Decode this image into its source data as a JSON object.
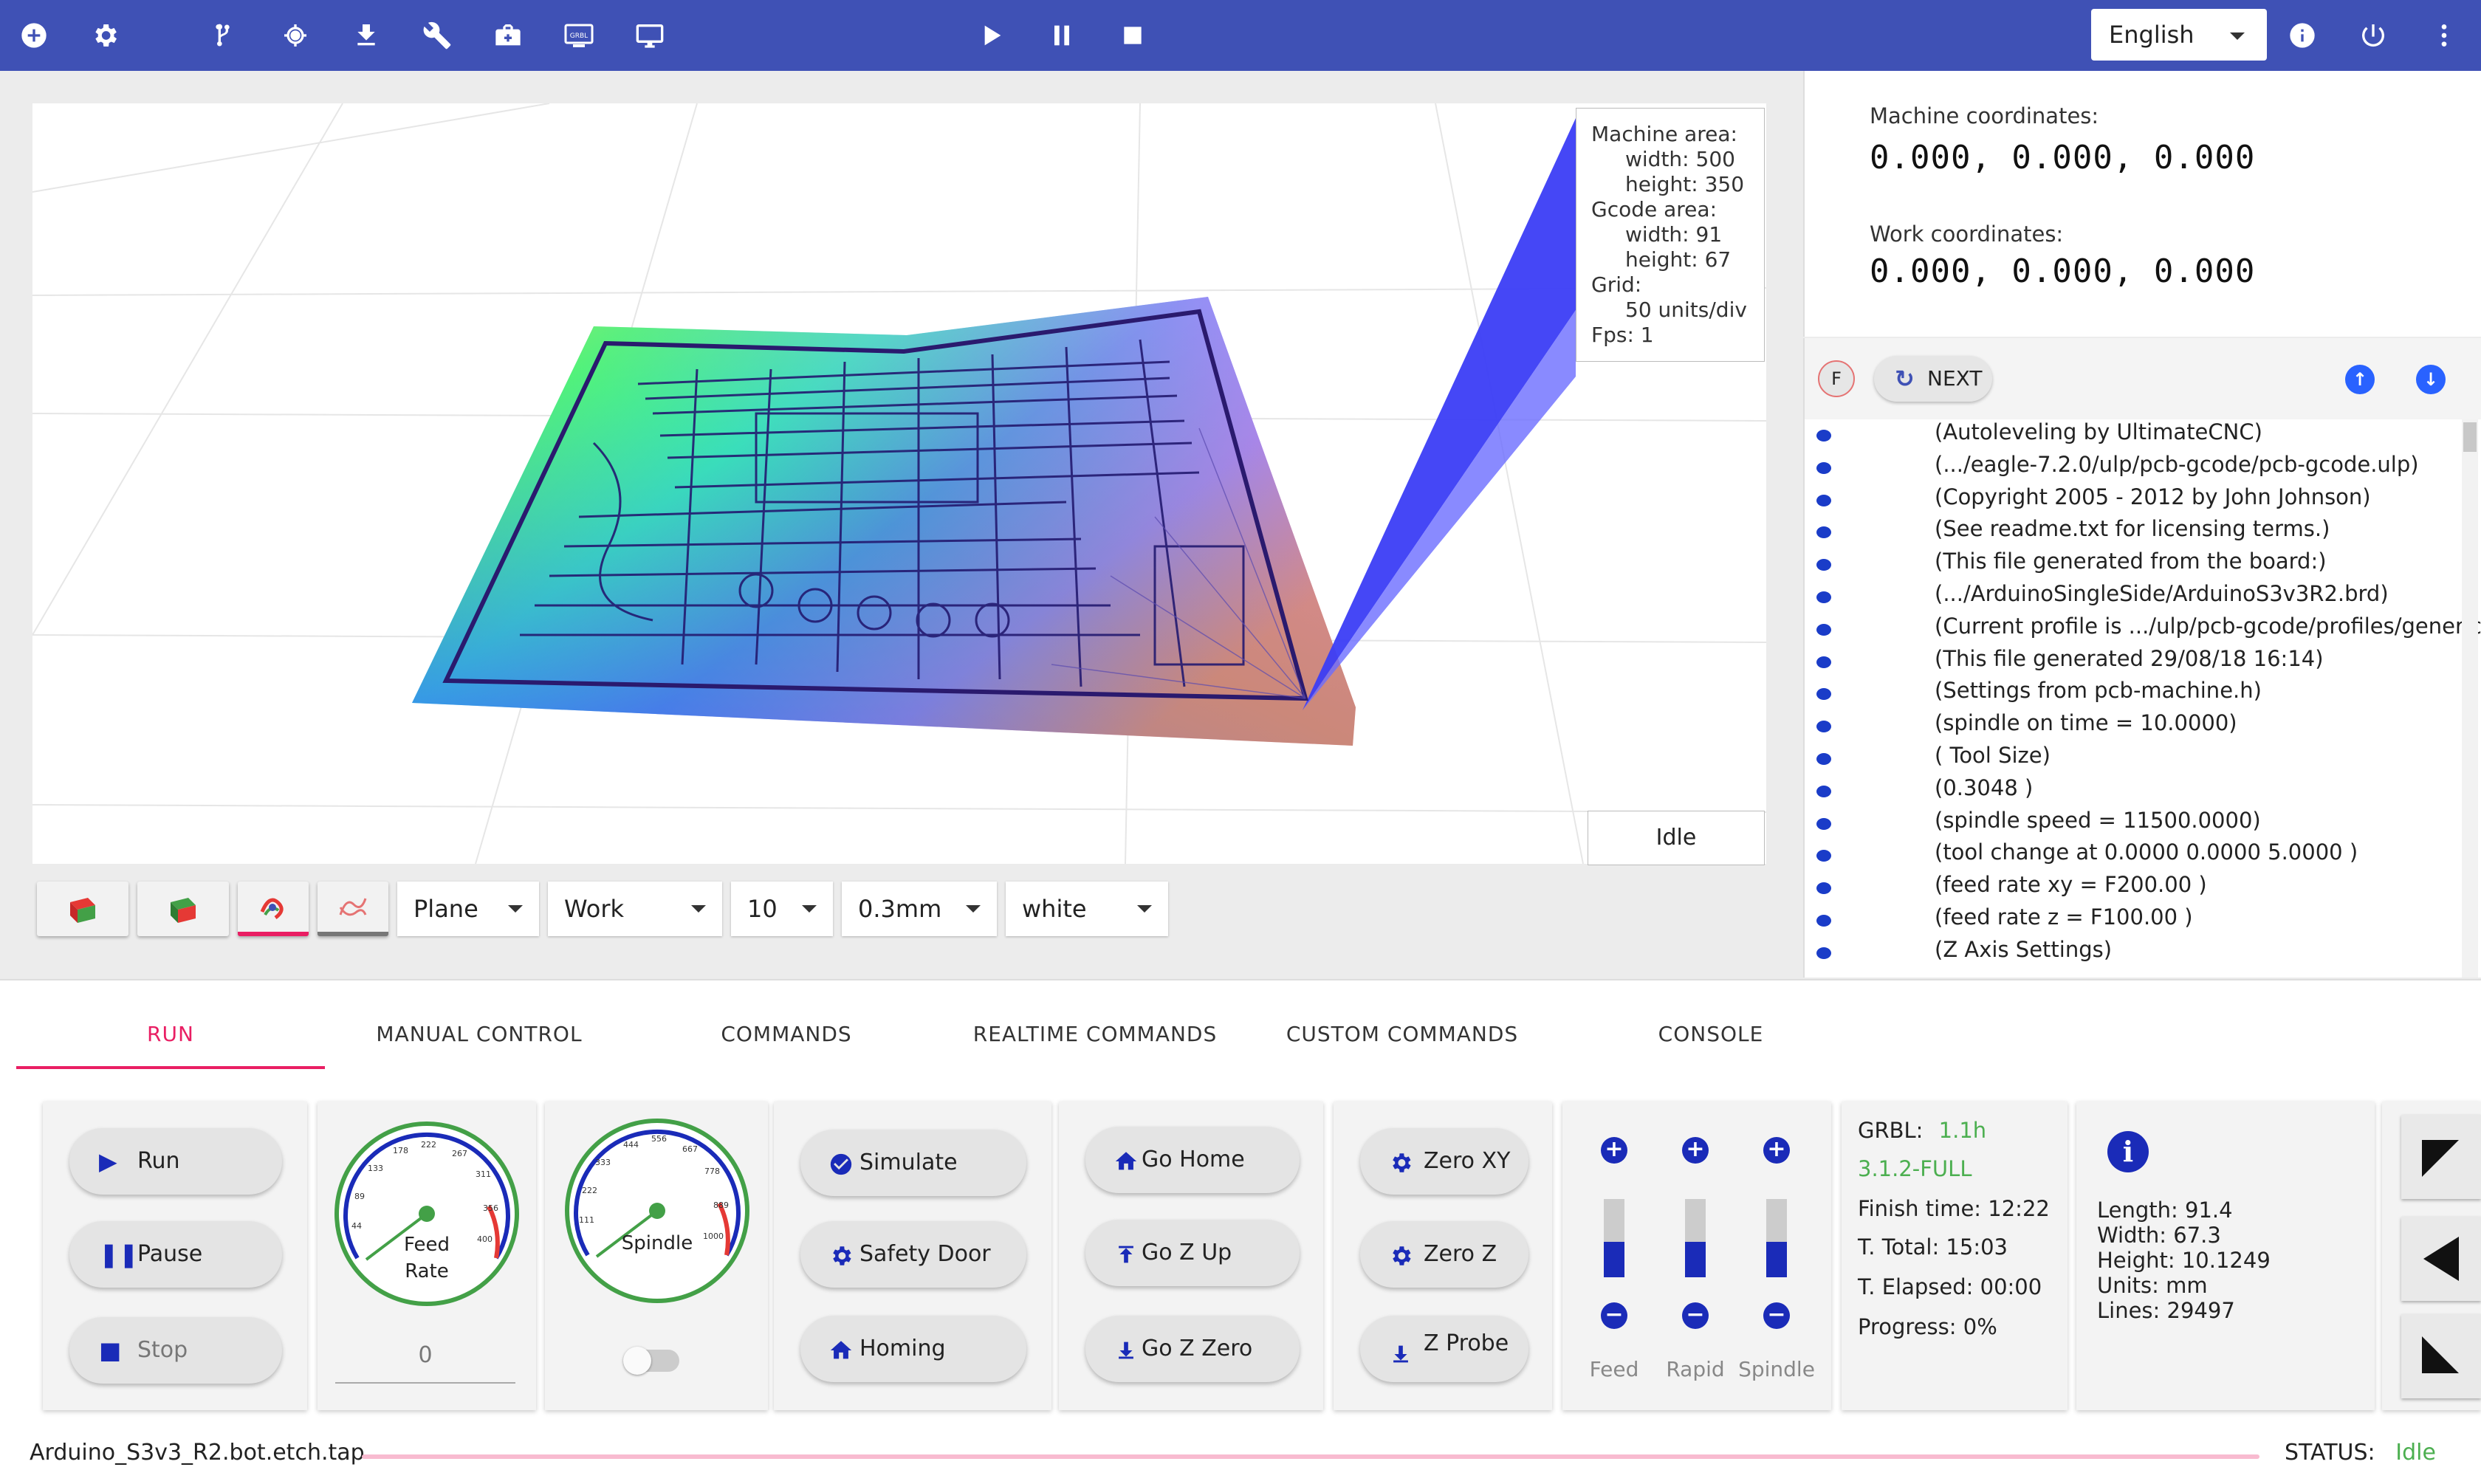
{
  "colors": {
    "primary": "#3f51b5",
    "accent": "#e91e63",
    "status_ok": "#4caf50",
    "icon_blue": "#1a2bb8"
  },
  "topbar": {
    "icons": [
      "add-circle-icon",
      "gear-icon",
      "branch-icon",
      "crosshair-icon",
      "download-icon",
      "wrench-icon",
      "briefcase-icon",
      "grbl-icon",
      "monitor-icon",
      "play-icon",
      "pause-icon",
      "stop-icon",
      "info-icon",
      "power-icon",
      "more-vert-icon"
    ],
    "grbl_label": "GRBL",
    "language": "English"
  },
  "viewer": {
    "info": {
      "machine_area": "Machine area:",
      "machine_width": "width: 500",
      "machine_height": "height: 350",
      "gcode_area": "Gcode area:",
      "gcode_width": "width: 91",
      "gcode_height": "height: 67",
      "grid": "Grid:",
      "grid_value": "50 units/div",
      "fps": "Fps: 1"
    },
    "state": "Idle",
    "selects": {
      "plane": "Plane",
      "coord": "Work",
      "size": "10",
      "tool": "0.3mm",
      "color": "white"
    }
  },
  "coords": {
    "machine_label": "Machine coordinates:",
    "machine_value": "0.000, 0.000, 0.000",
    "work_label": "Work coordinates:",
    "work_value": "0.000, 0.000, 0.000"
  },
  "gcode": {
    "f_label": "F",
    "next_label": "NEXT",
    "lines": [
      "(Autoleveling by UltimateCNC)",
      "(.../eagle-7.2.0/ulp/pcb-gcode/pcb-gcode.ulp)",
      "(Copyright 2005 - 2012 by John Johnson)",
      "(See readme.txt for licensing terms.)",
      "(This file generated from the board:)",
      "(.../ArduinoSingleSide/ArduinoS3v3R2.brd)",
      "(Current profile is .../ulp/pcb-gcode/profiles/generic.",
      "(This file generated 29/08/18 16:14)",
      "(Settings from pcb-machine.h)",
      "(spindle on time = 10.0000)",
      "(  Tool Size)",
      "(0.3048 )",
      "(spindle speed = 11500.0000)",
      "(tool change at 0.0000 0.0000 5.0000 )",
      "(feed rate xy = F200.00 )",
      "(feed rate z  = F100.00 )",
      "(Z Axis Settings)"
    ]
  },
  "tabs": [
    "RUN",
    "MANUAL CONTROL",
    "COMMANDS",
    "REALTIME COMMANDS",
    "CUSTOM COMMANDS",
    "CONSOLE"
  ],
  "run_panel": {
    "run": "Run",
    "pause": "Pause",
    "stop": "Stop"
  },
  "feed_gauge": {
    "label_1": "Feed",
    "label_2": "Rate",
    "ticks": [
      "44",
      "89",
      "133",
      "178",
      "222",
      "267",
      "311",
      "356",
      "400"
    ],
    "value": "0"
  },
  "spindle_gauge": {
    "label": "Spindle",
    "ticks": [
      "111",
      "222",
      "333",
      "444",
      "556",
      "667",
      "778",
      "889",
      "1000"
    ]
  },
  "commands": {
    "simulate": "Simulate",
    "safety_door": "Safety Door",
    "homing": "Homing"
  },
  "moves": {
    "go_home": "Go Home",
    "go_z_up": "Go Z Up",
    "go_z_zero": "Go Z Zero"
  },
  "zeros": {
    "zero_xy": "Zero XY",
    "zero_z": "Zero Z",
    "z_probe": "Z Probe"
  },
  "overrides": [
    {
      "label": "Feed",
      "level": 0.45
    },
    {
      "label": "Rapid",
      "level": 0.45
    },
    {
      "label": "Spindle",
      "level": 0.45
    }
  ],
  "grbl_status": {
    "grbl_label": "GRBL:",
    "grbl_ver": "1.1h",
    "grbl_build": "3.1.2-FULL",
    "finish": "Finish time: 12:22",
    "total": "T. Total: 15:03",
    "elapsed": "T. Elapsed: 00:00",
    "progress": "Progress: 0%"
  },
  "file_info": {
    "length": "Length: 91.4",
    "width": "Width: 67.3",
    "height": "Height: 10.1249",
    "units": "Units: mm",
    "lines": "Lines: 29497"
  },
  "footer": {
    "file": "Arduino_S3v3_R2.bot.etch.tap",
    "status_label": "STATUS:",
    "status_value": "Idle"
  }
}
